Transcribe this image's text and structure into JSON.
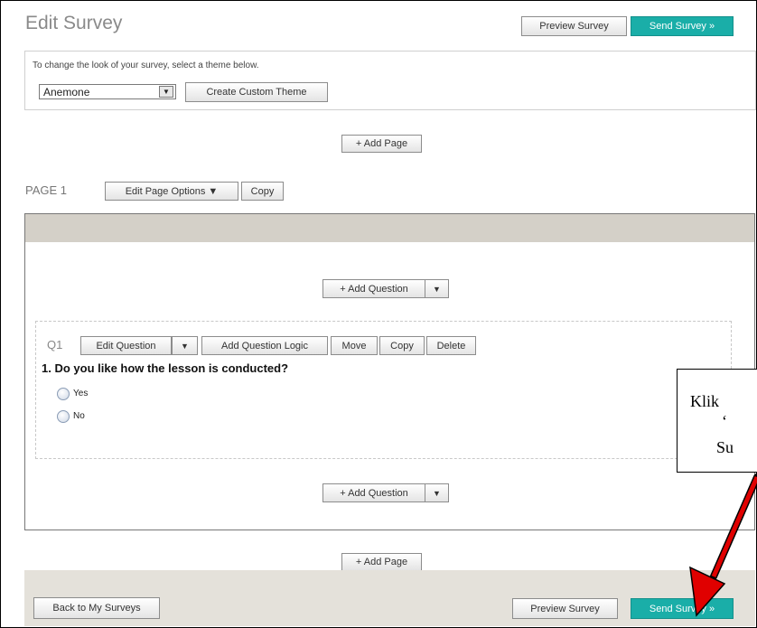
{
  "header": {
    "title": "Edit Survey",
    "preview_label": "Preview Survey",
    "send_label": "Send Survey »"
  },
  "theme": {
    "instruction": "To change the look of your survey, select a theme below.",
    "selected": "Anemone",
    "custom_label": "Create Custom Theme"
  },
  "add_page_label": "+ Add Page",
  "page": {
    "label": "PAGE 1",
    "options_label": "Edit Page Options ▼",
    "copy_label": "Copy",
    "add_question_label": "+ Add Question",
    "dropdown_glyph": "▼"
  },
  "question": {
    "number": "Q1",
    "edit_label": "Edit Question",
    "logic_label": "Add Question Logic",
    "move_label": "Move",
    "copy_label": "Copy",
    "delete_label": "Delete",
    "text": "1. Do you like how the lesson is conducted?",
    "options": [
      "Yes",
      "No"
    ]
  },
  "footer": {
    "back_label": "Back to My Surveys",
    "preview_label": "Preview Survey",
    "send_label": "Send Survey »"
  },
  "callout": {
    "lines": [
      "Klik",
      "‘",
      "Su"
    ]
  },
  "colors": {
    "accent": "#1aaea8",
    "arrow": "#e00000"
  }
}
